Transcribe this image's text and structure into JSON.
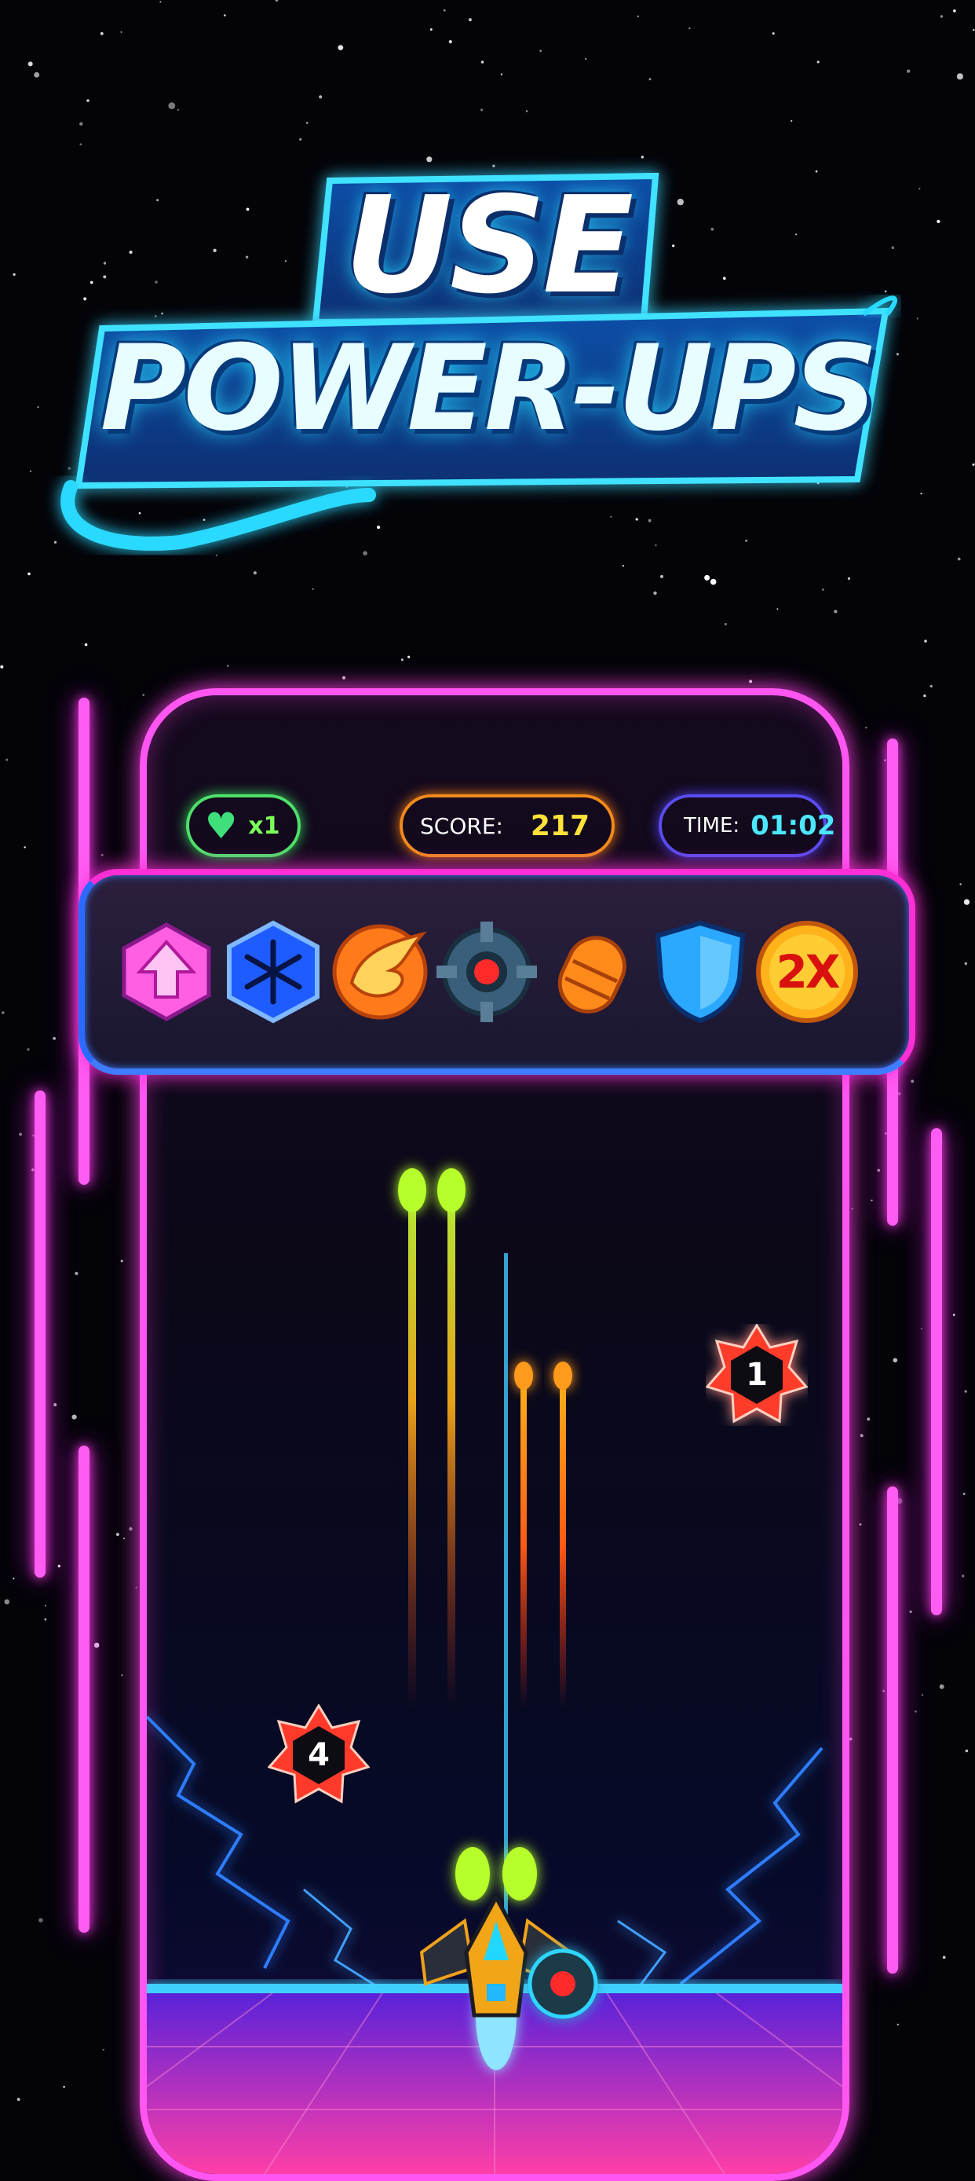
{
  "promo": {
    "title_line1": "USE",
    "title_line2": "POWER-UPS"
  },
  "hud": {
    "lives_icon": "heart-icon",
    "lives_value": "x1",
    "score_label": "SCORE:",
    "score_value": "217",
    "time_label": "TIME:",
    "time_value": "01:02"
  },
  "powerups": [
    {
      "name": "arrow-up-powerup-icon",
      "color": "#ff5fe0"
    },
    {
      "name": "snowflake-freeze-powerup-icon",
      "color": "#1f5cff"
    },
    {
      "name": "wing-speed-powerup-icon",
      "color": "#ff7a1a"
    },
    {
      "name": "turret-drone-powerup-icon",
      "color": "#3a5f7a"
    },
    {
      "name": "missile-powerup-icon",
      "color": "#ff8a1c"
    },
    {
      "name": "shield-powerup-icon",
      "color": "#2ba8ff"
    },
    {
      "name": "double-score-powerup-icon",
      "label": "2X",
      "color": "#ffb21a"
    }
  ],
  "enemies": [
    {
      "name": "enemy-mine",
      "hit_count": "1"
    },
    {
      "name": "enemy-mine",
      "hit_count": "4"
    }
  ],
  "colors": {
    "neon_pink": "#ff56f2",
    "neon_cyan": "#26d9ff",
    "lives_green": "#4fe06a",
    "score_orange": "#f28a1c",
    "time_blue": "#5a4cf0"
  }
}
